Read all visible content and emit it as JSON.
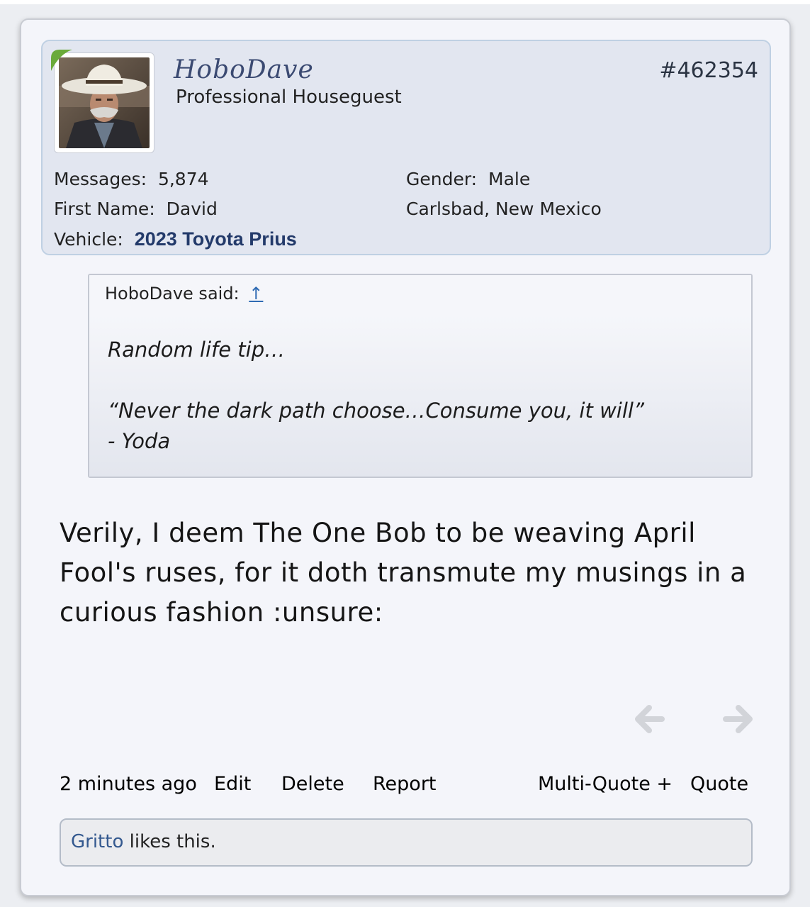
{
  "post": {
    "username": "HoboDave",
    "user_title": "Professional Houseguest",
    "post_number": "#462354",
    "info": {
      "messages_label": "Messages:",
      "messages_value": "5,874",
      "first_name_label": "First Name:",
      "first_name_value": "David",
      "vehicle_label": "Vehicle:",
      "vehicle_value": "2023 Toyota Prius",
      "gender_label": "Gender:",
      "gender_value": "Male",
      "location": "Carlsbad, New Mexico"
    },
    "quote": {
      "attribution": "HoboDave said:",
      "jump_glyph": "↑",
      "line1": "Random life tip…",
      "line2": "“Never the dark path choose…Consume you, it will”",
      "line3": "- Yoda"
    },
    "message": "Verily, I deem The One Bob to be weaving April Fool's ruses, for it doth transmute my musings in a curious fashion :unsure:",
    "footer": {
      "time": "2 minutes ago",
      "edit": "Edit",
      "delete": "Delete",
      "report": "Report",
      "multi_quote": "Multi-Quote +",
      "quote": "Quote"
    },
    "likes": {
      "liker": "Gritto",
      "suffix": " likes this."
    }
  },
  "icons": {
    "prev": "arrow-left-icon",
    "next": "arrow-right-icon",
    "online": "online-indicator-icon"
  },
  "colors": {
    "link": "#34598f",
    "vehicle_link": "#233a6a",
    "online": "#6aaa3a"
  }
}
